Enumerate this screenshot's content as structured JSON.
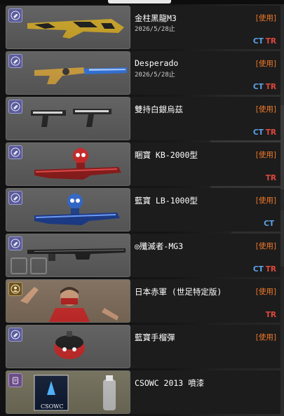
{
  "colors": {
    "use_orange": "#f07a2a",
    "ct_blue": "#5ea2e8",
    "tr_red": "#e0483d",
    "card_bg": "#5a5a5a",
    "info_bg": "#1c1c1c"
  },
  "items": [
    {
      "name": "金柱黑龍M3",
      "date": "2026/5/28止",
      "action": "[使用]",
      "ct": "CT",
      "tr": "TR",
      "badge_icon": "bullet-icon"
    },
    {
      "name": "Desperado",
      "date": "2026/5/28止",
      "action": "[使用]",
      "ct": "CT",
      "tr": "TR",
      "badge_icon": "bullet-icon"
    },
    {
      "name": "雙持白銀烏茲",
      "date": "",
      "action": "[使用]",
      "ct": "CT",
      "tr": "TR",
      "badge_icon": "bullet-icon"
    },
    {
      "name": "睏寶 KB-2000型",
      "date": "",
      "action": "[使用]",
      "ct": "",
      "tr": "TR",
      "badge_icon": "bullet-icon"
    },
    {
      "name": "藍寶 LB-1000型",
      "date": "",
      "action": "[使用]",
      "ct": "CT",
      "tr": "",
      "badge_icon": "bullet-icon"
    },
    {
      "name": "◎殲滅者-MG3",
      "date": "",
      "action": "[使用]",
      "ct": "CT",
      "tr": "TR",
      "badge_icon": "bullet-icon"
    },
    {
      "name": "日本赤軍 (世足特定版)",
      "date": "",
      "action": "[使用]",
      "ct": "",
      "tr": "TR",
      "badge_icon": "person-icon"
    },
    {
      "name": "藍寶手榴彈",
      "date": "",
      "action": "[使用]",
      "ct": "",
      "tr": "",
      "badge_icon": "bullet-icon"
    },
    {
      "name": "CSOWC 2013 噴漆",
      "date": "",
      "action": "",
      "ct": "",
      "tr": "",
      "badge_icon": "spray-icon",
      "logo_text": "CSOWC"
    }
  ]
}
